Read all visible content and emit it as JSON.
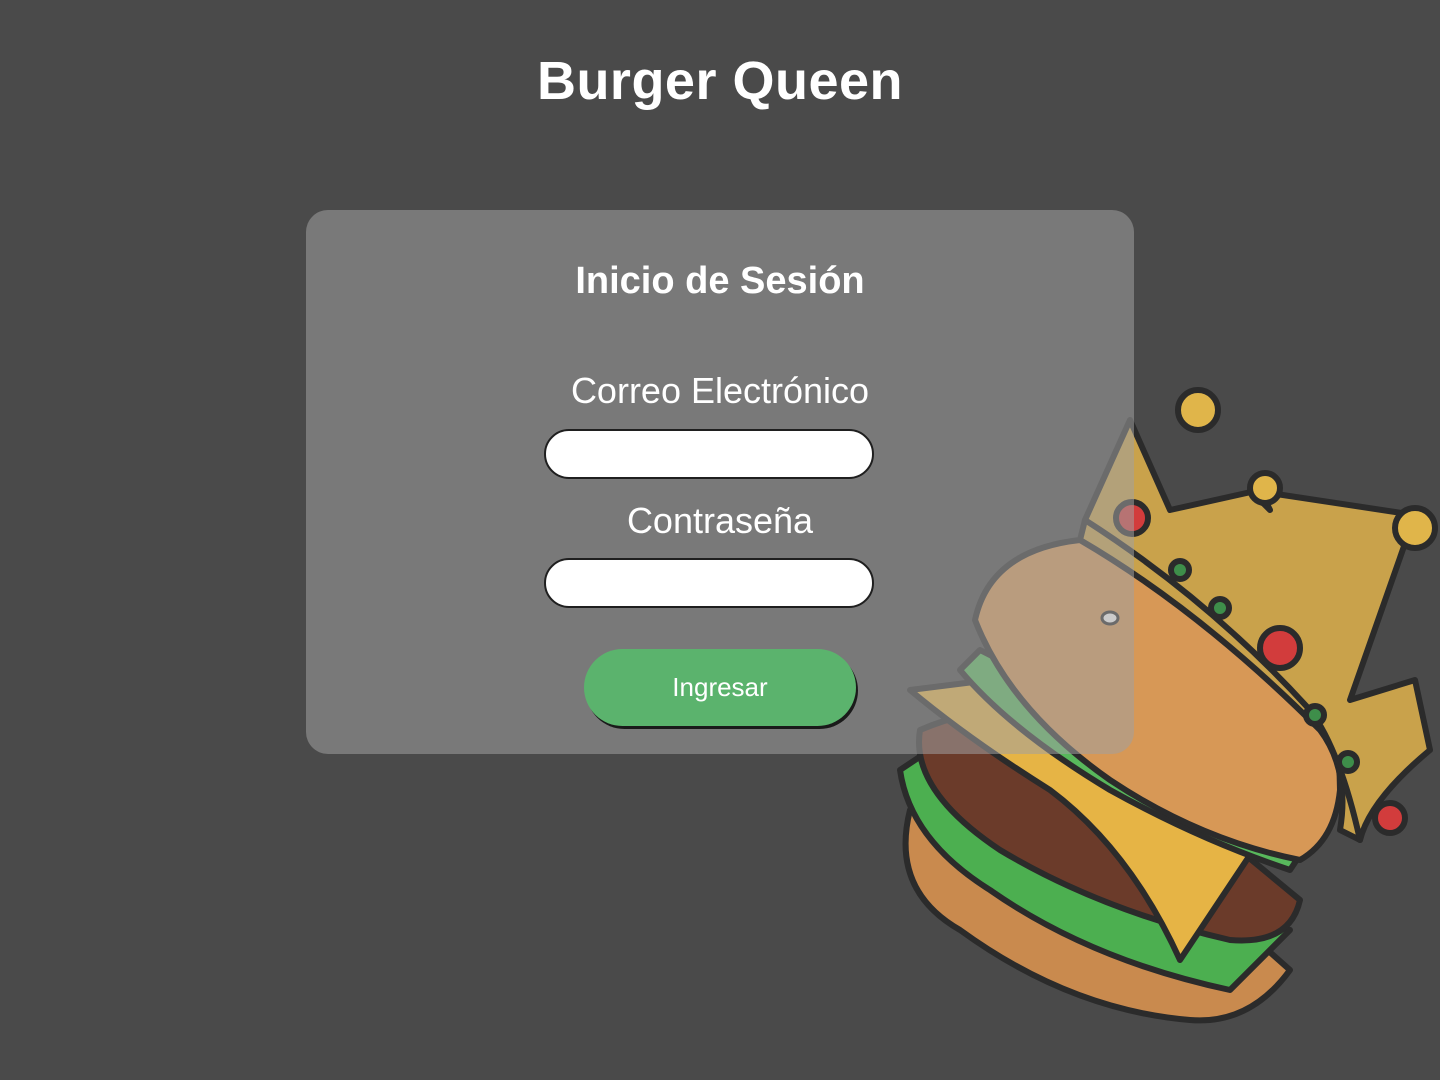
{
  "app": {
    "title": "Burger Queen"
  },
  "login": {
    "title": "Inicio de Sesión",
    "email_label": "Correo Electrónico",
    "email_value": "",
    "password_label": "Contraseña",
    "password_value": "",
    "submit_label": "Ingresar"
  },
  "icons": {
    "mascot": "crowned-burger-illustration"
  },
  "colors": {
    "background": "#4a4a4a",
    "card": "#8a8a8a",
    "button": "#5bb36d",
    "text": "#ffffff"
  }
}
